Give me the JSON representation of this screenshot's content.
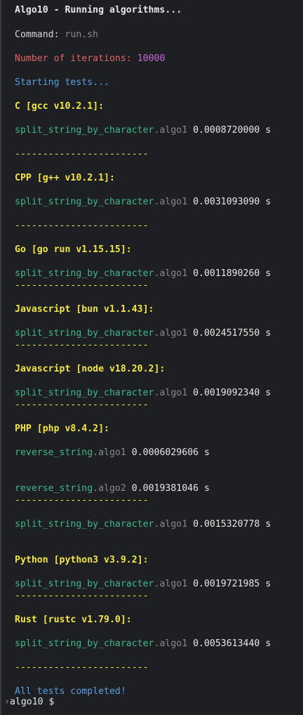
{
  "window": {
    "title": "Algo10 - Running algorithms..."
  },
  "header": {
    "command_label": "Command:",
    "command_value": "run.sh",
    "iterations_label": "Number of iterations:",
    "iterations_value": "10000",
    "starting": "Starting tests..."
  },
  "separator": "------------------------",
  "unit": "s",
  "sections": [
    {
      "title": "C [gcc v10.2.1]:",
      "results": [
        {
          "func": "split_string_by_character",
          "algo": ".algo1",
          "time": "0.0008720000"
        }
      ]
    },
    {
      "title": "CPP [g++ v10.2.1]:",
      "results": [
        {
          "func": "split_string_by_character",
          "algo": ".algo1",
          "time": "0.0031093090"
        }
      ]
    },
    {
      "title": "Go [go run v1.15.15]:",
      "results": [
        {
          "func": "split_string_by_character",
          "algo": ".algo1",
          "time": "0.0011890260"
        }
      ]
    },
    {
      "title": "Javascript [bun v1.1.43]:",
      "results": [
        {
          "func": "split_string_by_character",
          "algo": ".algo1",
          "time": "0.0024517550"
        }
      ]
    },
    {
      "title": "Javascript [node v18.20.2]:",
      "results": [
        {
          "func": "split_string_by_character",
          "algo": ".algo1",
          "time": "0.0019092340"
        }
      ]
    },
    {
      "title": "PHP [php v8.4.2]:",
      "results": [
        {
          "func": "reverse_string",
          "algo": ".algo1",
          "time": "0.0006029606"
        },
        {
          "func": "reverse_string",
          "algo": ".algo2",
          "time": "0.0019381046"
        },
        {
          "func": "split_string_by_character",
          "algo": ".algo1",
          "time": "0.0015320778"
        }
      ]
    },
    {
      "title": "Python [python3 v3.9.2]:",
      "results": [
        {
          "func": "split_string_by_character",
          "algo": ".algo1",
          "time": "0.0019721985"
        }
      ]
    },
    {
      "title": "Rust [rustc v1.79.0]:",
      "results": [
        {
          "func": "split_string_by_character",
          "algo": ".algo1",
          "time": "0.0053613440"
        }
      ]
    }
  ],
  "footer": {
    "completed": "All tests completed!",
    "prompt_host": "algo10",
    "prompt_symbol": "$"
  },
  "colors": {
    "background": "#1e1f22",
    "section_title": "#f2e64a",
    "function_name": "#41b78a",
    "info": "#5a9fe0",
    "iterations_label": "#e06464",
    "iterations_value": "#c667d8"
  }
}
